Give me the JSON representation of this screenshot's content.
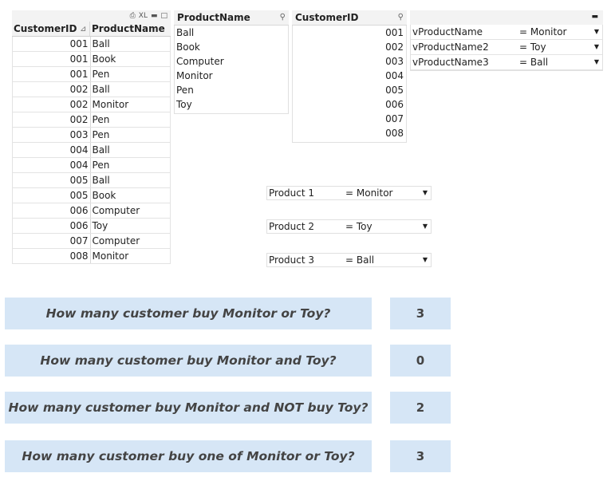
{
  "table": {
    "caption_icons": [
      "print-icon",
      "xl-icon",
      "minimize-icon",
      "maximize-icon"
    ],
    "xl_label": "XL",
    "headers": [
      "CustomerID",
      "ProductName"
    ],
    "rows": [
      [
        "001",
        "Ball"
      ],
      [
        "001",
        "Book"
      ],
      [
        "001",
        "Pen"
      ],
      [
        "002",
        "Ball"
      ],
      [
        "002",
        "Monitor"
      ],
      [
        "002",
        "Pen"
      ],
      [
        "003",
        "Pen"
      ],
      [
        "004",
        "Ball"
      ],
      [
        "004",
        "Pen"
      ],
      [
        "005",
        "Ball"
      ],
      [
        "005",
        "Book"
      ],
      [
        "006",
        "Computer"
      ],
      [
        "006",
        "Toy"
      ],
      [
        "007",
        "Computer"
      ],
      [
        "008",
        "Monitor"
      ]
    ]
  },
  "product_list": {
    "title": "ProductName",
    "items": [
      "Ball",
      "Book",
      "Computer",
      "Monitor",
      "Pen",
      "Toy"
    ]
  },
  "customer_list": {
    "title": "CustomerID",
    "items": [
      "001",
      "002",
      "003",
      "004",
      "005",
      "006",
      "007",
      "008"
    ]
  },
  "variables": [
    {
      "name": "vProductName",
      "value": "= Monitor"
    },
    {
      "name": "vProductName2",
      "value": "= Toy"
    },
    {
      "name": "vProductName3",
      "value": "= Ball"
    }
  ],
  "product_selectors": [
    {
      "label": "Product 1",
      "value": "= Monitor"
    },
    {
      "label": "Product 2",
      "value": "= Toy"
    },
    {
      "label": "Product 3",
      "value": "= Ball"
    }
  ],
  "questions": [
    {
      "text": "How many customer buy Monitor or Toy?",
      "answer": "3"
    },
    {
      "text": "How many customer buy Monitor and Toy?",
      "answer": "0"
    },
    {
      "text": "How many customer buy Monitor and NOT buy Toy?",
      "answer": "2"
    },
    {
      "text": "How many customer buy one of Monitor or Toy?",
      "answer": "3"
    }
  ],
  "colors": {
    "question_bg": "#d6e6f6",
    "header_bg": "#f3f3f3"
  }
}
